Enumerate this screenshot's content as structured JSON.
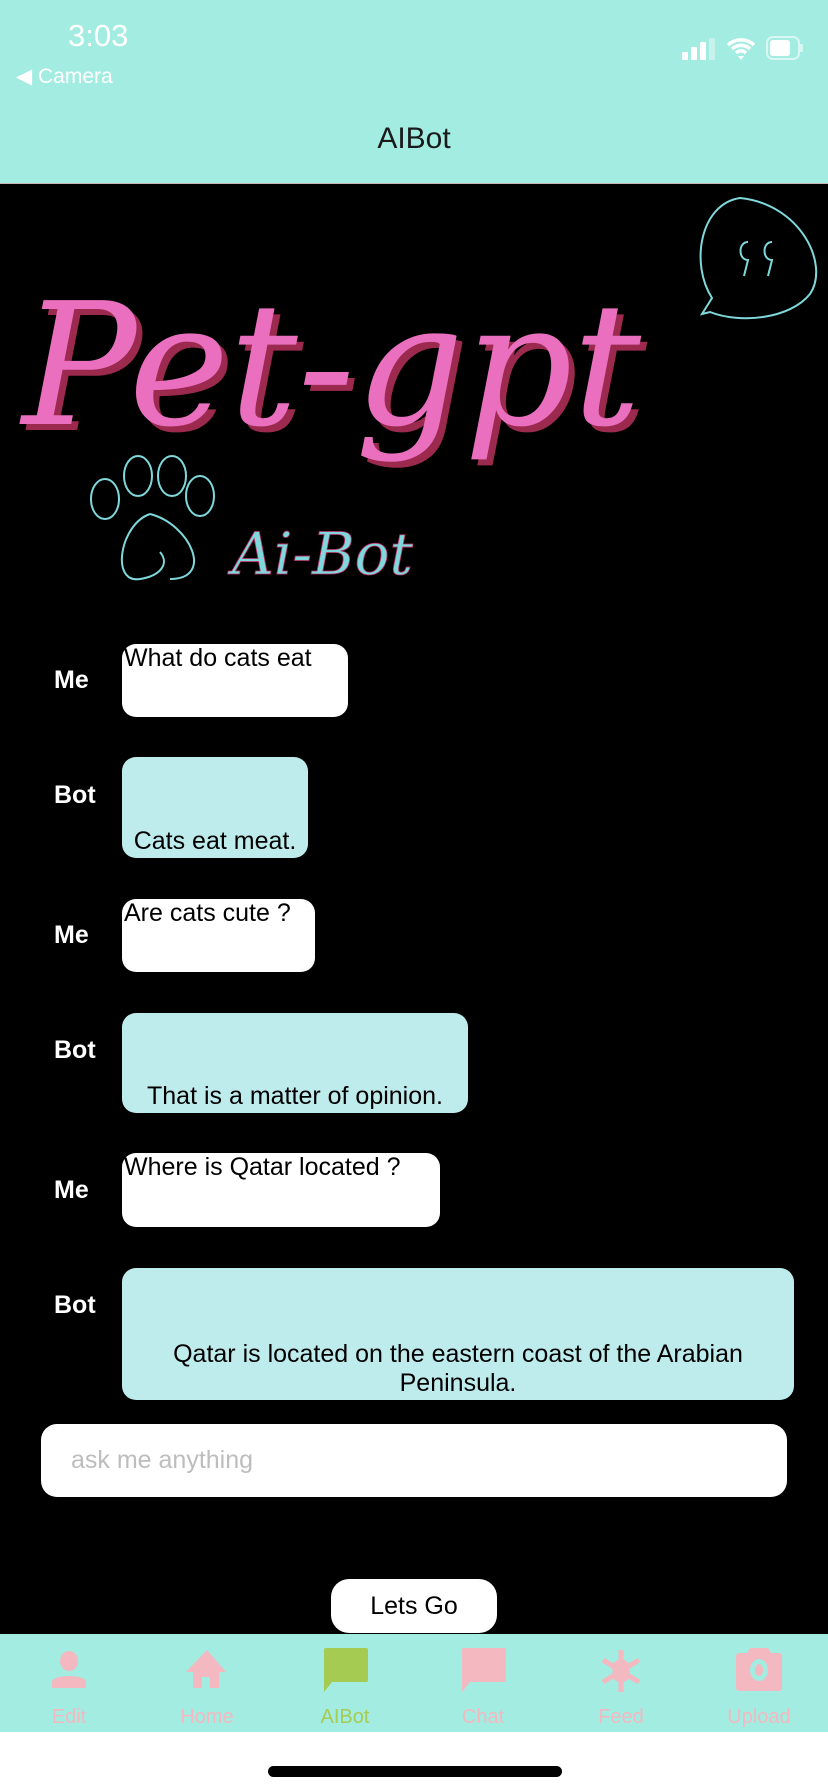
{
  "status": {
    "time": "3:03",
    "back_label": "Camera"
  },
  "header": {
    "title": "AIBot"
  },
  "logo": {
    "title": "Pet-gpt",
    "subtitle": "Ai-Bot"
  },
  "messages": [
    {
      "sender": "Me",
      "text": "What do cats eat"
    },
    {
      "sender": "Bot",
      "text": "Cats eat meat."
    },
    {
      "sender": "Me",
      "text": "Are cats cute ?"
    },
    {
      "sender": "Bot",
      "text": "That is a matter of opinion."
    },
    {
      "sender": "Me",
      "text": "Where is Qatar located ?"
    },
    {
      "sender": "Bot",
      "text": "Qatar is located on the eastern coast of the Arabian Peninsula."
    }
  ],
  "input": {
    "placeholder": "ask me anything",
    "value": ""
  },
  "submit_label": "Lets Go",
  "tabs": [
    {
      "label": "Edit",
      "icon": "person-icon"
    },
    {
      "label": "Home",
      "icon": "home-icon"
    },
    {
      "label": "AIBot",
      "icon": "chat-bubble-icon",
      "active": true
    },
    {
      "label": "Chat",
      "icon": "chat-bubble-icon"
    },
    {
      "label": "Feed",
      "icon": "snowflake-icon"
    },
    {
      "label": "Upload",
      "icon": "camera-icon"
    }
  ],
  "colors": {
    "header": "#a3ece2",
    "bot_bubble": "#beecec",
    "tab_inactive": "#f4b8c0",
    "tab_active": "#a5cb52",
    "logo_pink": "#ea6fbf",
    "logo_cyan": "#7fd8dc"
  }
}
